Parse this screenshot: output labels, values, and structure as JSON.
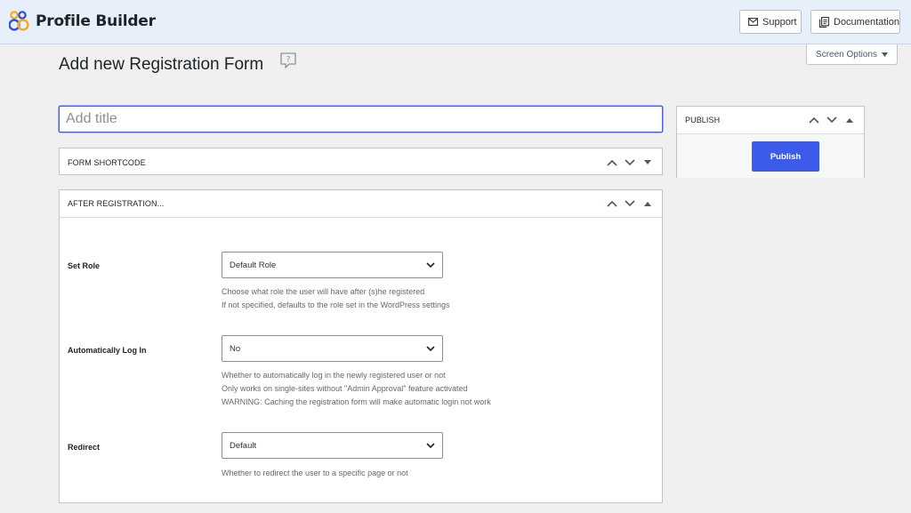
{
  "header": {
    "brand_name": "Profile Builder",
    "support_label": "Support",
    "documentation_label": "Documentation"
  },
  "screen_options_label": "Screen Options",
  "page_title": "Add new Registration Form",
  "title_field": {
    "placeholder": "Add title",
    "value": ""
  },
  "form_shortcode_box": {
    "title": "Form Shortcode"
  },
  "after_registration_box": {
    "title": "After Registration...",
    "fields": [
      {
        "label": "Set Role",
        "value": "Default Role",
        "description": [
          "Choose what role the user will have after (s)he registered",
          "If not specified, defaults to the role set in the WordPress settings"
        ]
      },
      {
        "label": "Automatically Log In",
        "value": "No",
        "description": [
          "Whether to automatically log in the newly registered user or not",
          "Only works on single-sites without \"Admin Approval\" feature activated",
          "WARNING: Caching the registration form will make automatic login not work"
        ]
      },
      {
        "label": "Redirect",
        "value": "Default",
        "description": [
          "Whether to redirect the user to a specific page or not"
        ]
      }
    ]
  },
  "publish_box": {
    "title": "Publish",
    "button_label": "Publish"
  },
  "colors": {
    "accent": "#3c5be8",
    "header_bg": "#e7effb",
    "page_bg": "#f0f0f1",
    "logo_orange": "#f5a623",
    "logo_blue": "#2f4fd6"
  }
}
